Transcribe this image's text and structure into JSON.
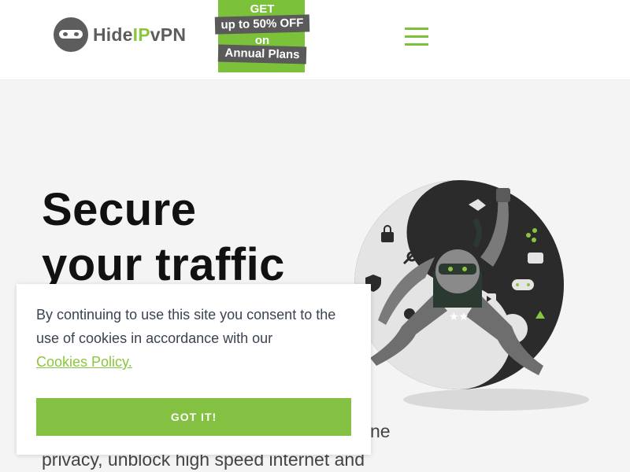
{
  "header": {
    "logo": {
      "text_prefix": "Hide",
      "text_ip": "IP",
      "text_suffix": "vPN"
    },
    "promo": {
      "line1": "GET",
      "line2": "up to 50% OFF",
      "line3": "on",
      "line4": "Annual Plans"
    },
    "menu_icon": "hamburger-icon"
  },
  "hero": {
    "title_line1": "Secure",
    "title_line2": "your traffic",
    "subtitle_visible_line1": "ne",
    "subtitle_visible_line2": "privacy, unblock high speed internet and",
    "illustration": "ninja-illustration"
  },
  "cookie_banner": {
    "text": "By continuing to use this site you consent to the use of cookies in accordance with our",
    "link_label": "Cookies Policy.",
    "button_label": "GOT IT!"
  },
  "colors": {
    "brand_green": "#8bc53f",
    "button_green": "#84c041",
    "logo_gray": "#5d5d5d",
    "page_bg": "#f4f4f4"
  }
}
